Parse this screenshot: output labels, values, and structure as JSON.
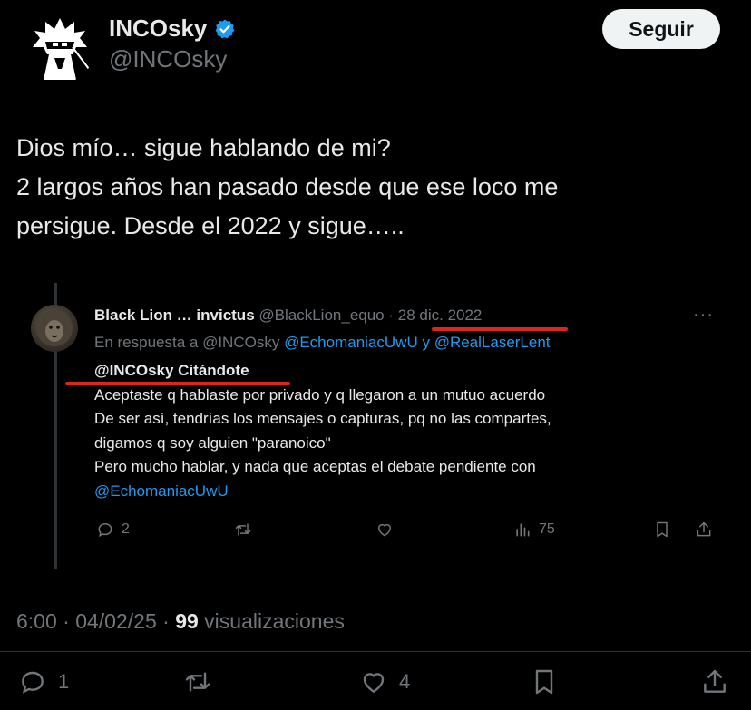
{
  "author": {
    "display_name": "INCOsky",
    "handle": "@INCOsky",
    "verified_icon": "verified-badge-icon",
    "follow_label": "Seguir"
  },
  "tweet": {
    "lines": [
      "Dios mío… sigue hablando de mi?",
      "2 largos años han pasado desde que ese loco me",
      "persigue. Desde el 2022 y sigue….."
    ]
  },
  "quoted": {
    "name": "Black Lion … invictus",
    "handle": "@BlackLion_equo",
    "date": "· 28 dic. 2022",
    "more": "···",
    "reply_prefix": "En respuesta a @INCOsky",
    "reply_mention1": "@EchomaniacUwU",
    "reply_joiner": "y",
    "reply_mention2": "@RealLaserLent",
    "body_first": "@INCOsky Citándote",
    "body_lines": [
      "Aceptaste q hablaste por privado y q llegaron a un mutuo acuerdo",
      "De ser así, tendrías los mensajes o capturas, pq no las compartes,",
      "digamos q soy alguien \"paranoico\"",
      "Pero mucho hablar, y nada que aceptas el debate pendiente con"
    ],
    "body_last_mention": "@EchomaniacUwU",
    "replies": "2",
    "views": "75",
    "annotation_color": "#e0231e"
  },
  "meta": {
    "time": "6:00 · 04/02/25 ·",
    "views_count": "99",
    "views_label": "visualizaciones"
  },
  "actions": {
    "replies": "1",
    "likes": "4"
  },
  "colors": {
    "background": "#000000",
    "text": "#e7e9ea",
    "muted": "#71767b",
    "link": "#1d9bf0",
    "verified": "#1d9bf0"
  }
}
